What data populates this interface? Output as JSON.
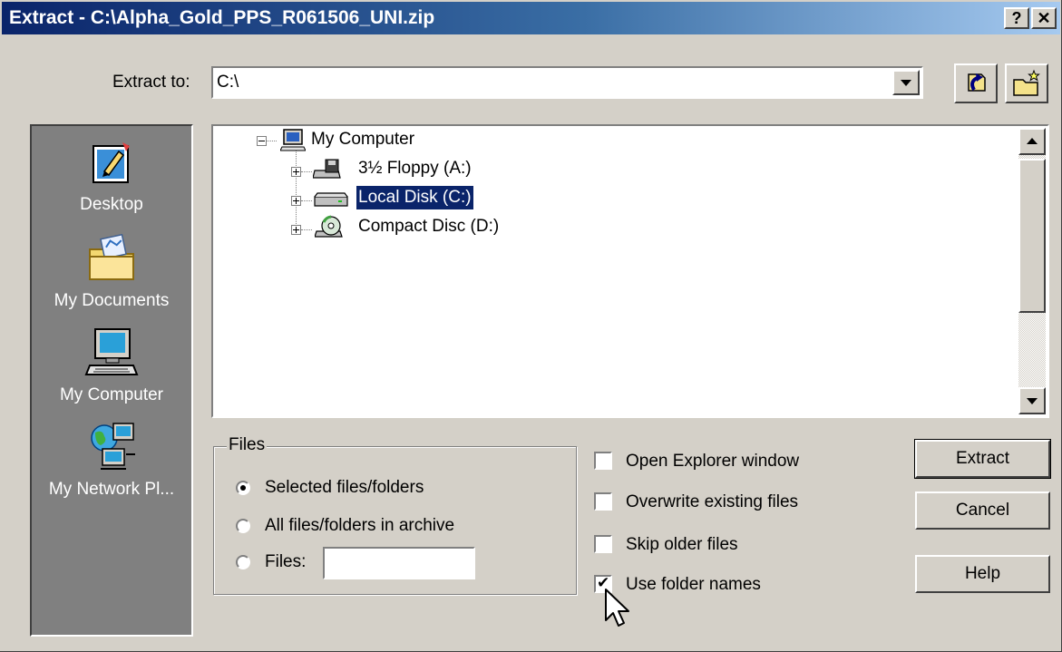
{
  "window": {
    "title": "Extract - C:\\Alpha_Gold_PPS_R061506_UNI.zip",
    "help_button": "?",
    "close_button": "✕"
  },
  "extract_to": {
    "label": "Extract to:",
    "value": "C:\\"
  },
  "toolbar": {
    "go_up_icon": "go-up-icon",
    "new_folder_icon": "new-folder-icon"
  },
  "places": [
    {
      "label": "Desktop",
      "icon": "desktop-icon"
    },
    {
      "label": "My Documents",
      "icon": "my-documents-icon"
    },
    {
      "label": "My Computer",
      "icon": "my-computer-icon"
    },
    {
      "label": "My Network Pl...",
      "icon": "my-network-places-icon"
    }
  ],
  "tree": {
    "root": {
      "label": "My Computer",
      "icon": "computer-icon",
      "expanded": true
    },
    "children": [
      {
        "label": "3½ Floppy (A:)",
        "icon": "floppy-icon",
        "selected": false
      },
      {
        "label": "Local Disk (C:)",
        "icon": "hard-disk-icon",
        "selected": true
      },
      {
        "label": "Compact Disc (D:)",
        "icon": "cd-icon",
        "selected": false
      }
    ]
  },
  "files_group": {
    "title": "Files",
    "options": [
      {
        "label": "Selected files/folders",
        "checked": true
      },
      {
        "label": "All files/folders in archive",
        "checked": false
      },
      {
        "label": "Files:",
        "checked": false
      }
    ],
    "files_input_value": ""
  },
  "options": [
    {
      "label": "Open Explorer window",
      "checked": false
    },
    {
      "label": "Overwrite existing files",
      "checked": false
    },
    {
      "label": "Skip older files",
      "checked": false
    },
    {
      "label": "Use folder names",
      "checked": true
    }
  ],
  "buttons": {
    "extract": "Extract",
    "cancel": "Cancel",
    "help": "Help"
  },
  "colors": {
    "title_bar": "#0a246a",
    "face": "#d4d0c8",
    "places_bar": "#808080",
    "selection": "#0a246a"
  }
}
